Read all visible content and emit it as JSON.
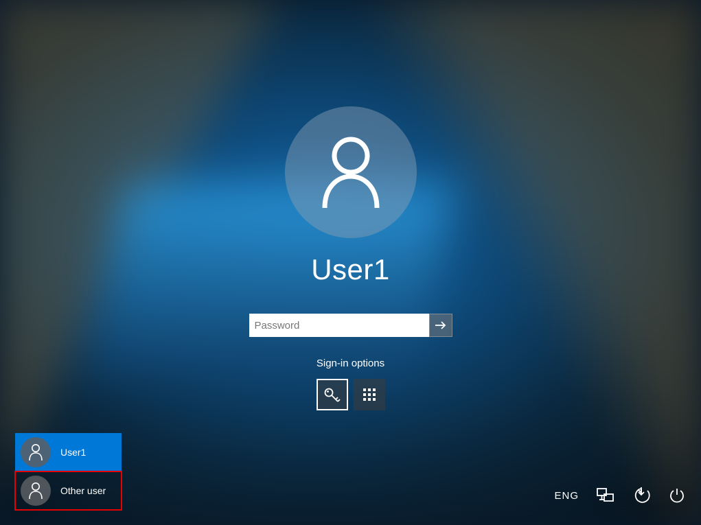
{
  "current_user": "User1",
  "password": {
    "placeholder": "Password",
    "value": ""
  },
  "signin_options_label": "Sign-in options",
  "options": {
    "key_selected": true,
    "pin_selected": false
  },
  "user_list": [
    {
      "label": "User1",
      "selected": true,
      "highlighted": false
    },
    {
      "label": "Other user",
      "selected": false,
      "highlighted": true
    }
  ],
  "corner": {
    "language": "ENG"
  }
}
